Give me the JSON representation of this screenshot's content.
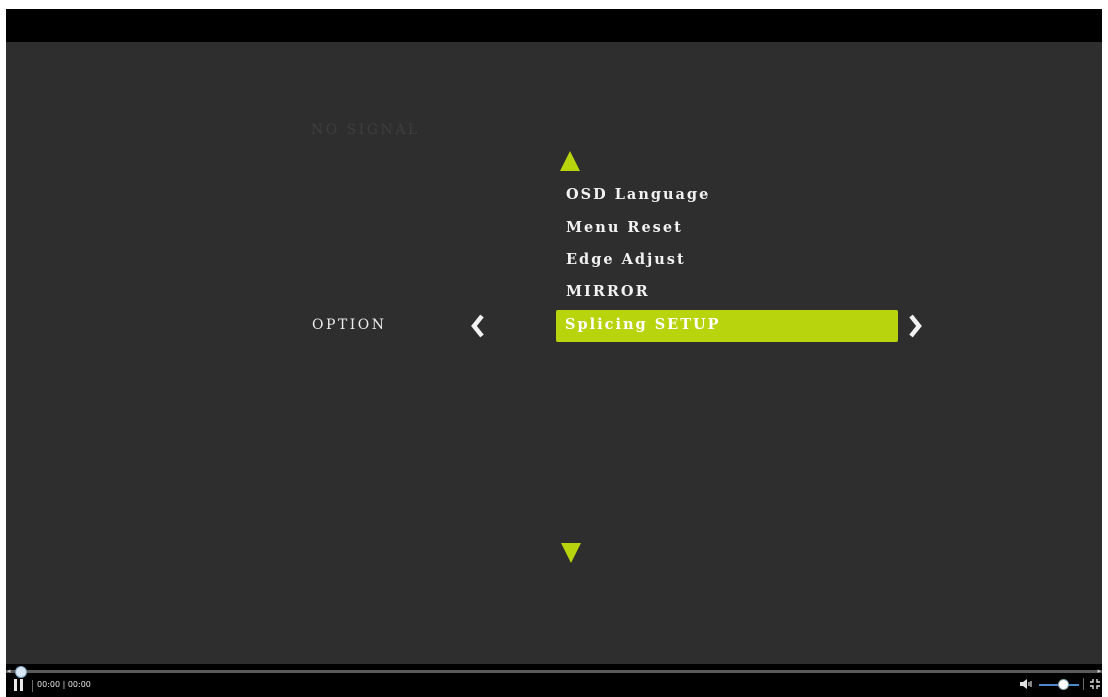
{
  "osd": {
    "status_text": "NO SIGNAL",
    "category_label": "OPTION",
    "menu_items": [
      "OSD Language",
      "Menu Reset",
      "Edge Adjust",
      "MIRROR"
    ],
    "selected_item": "Splicing SETUP",
    "accent_color": "#b8d40c",
    "icons": {
      "scroll_up": "triangle-up-icon",
      "scroll_down": "triangle-down-icon",
      "prev": "chevron-left-icon",
      "next": "chevron-right-icon"
    }
  },
  "player": {
    "time_display": "00:00 | 00:00",
    "seek_progress": 0.0,
    "volume_level": 0.6,
    "icons": {
      "play_pause": "pause-icon",
      "volume": "volume-icon",
      "fullscreen": "fullscreen-icon"
    }
  }
}
